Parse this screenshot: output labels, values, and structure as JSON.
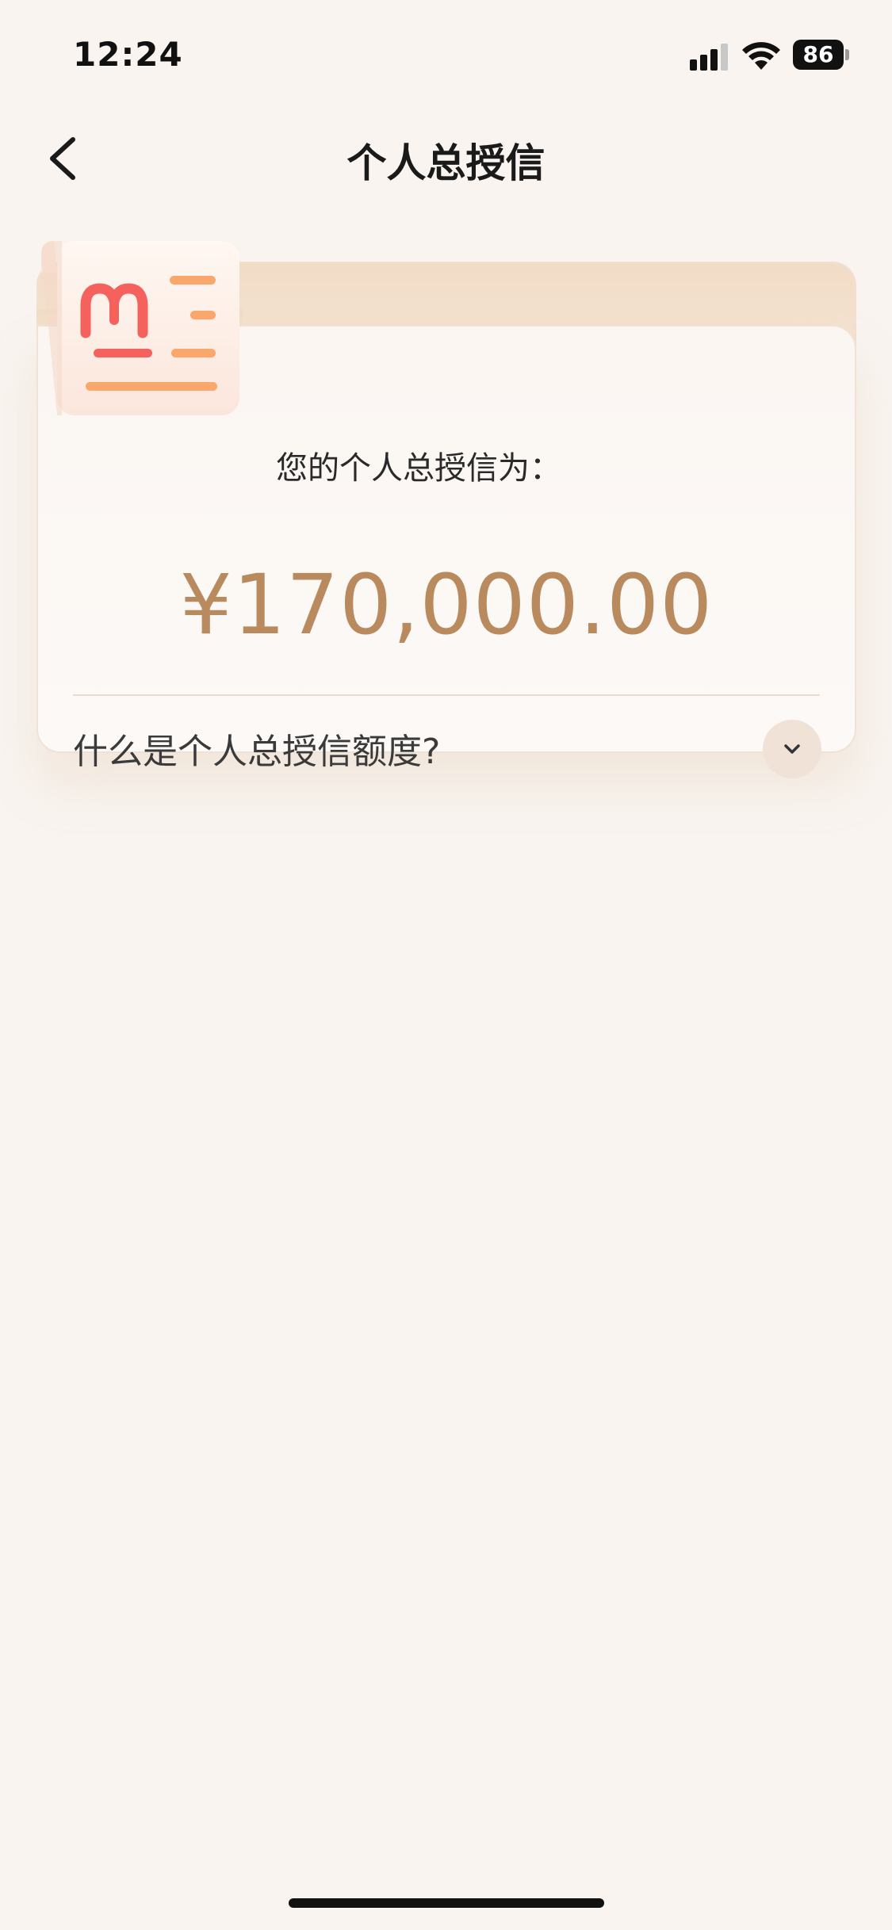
{
  "status_bar": {
    "time": "12:24",
    "battery": "86"
  },
  "nav": {
    "title": "个人总授信"
  },
  "card": {
    "subtitle": "您的个人总授信为：",
    "amount": "¥170,000.00",
    "faq_label": "什么是个人总授信额度?"
  },
  "colors": {
    "background": "#f9f4f0",
    "amount": "#b98a5e",
    "icon_red": "#f5615c",
    "icon_orange": "#f9a76a"
  }
}
